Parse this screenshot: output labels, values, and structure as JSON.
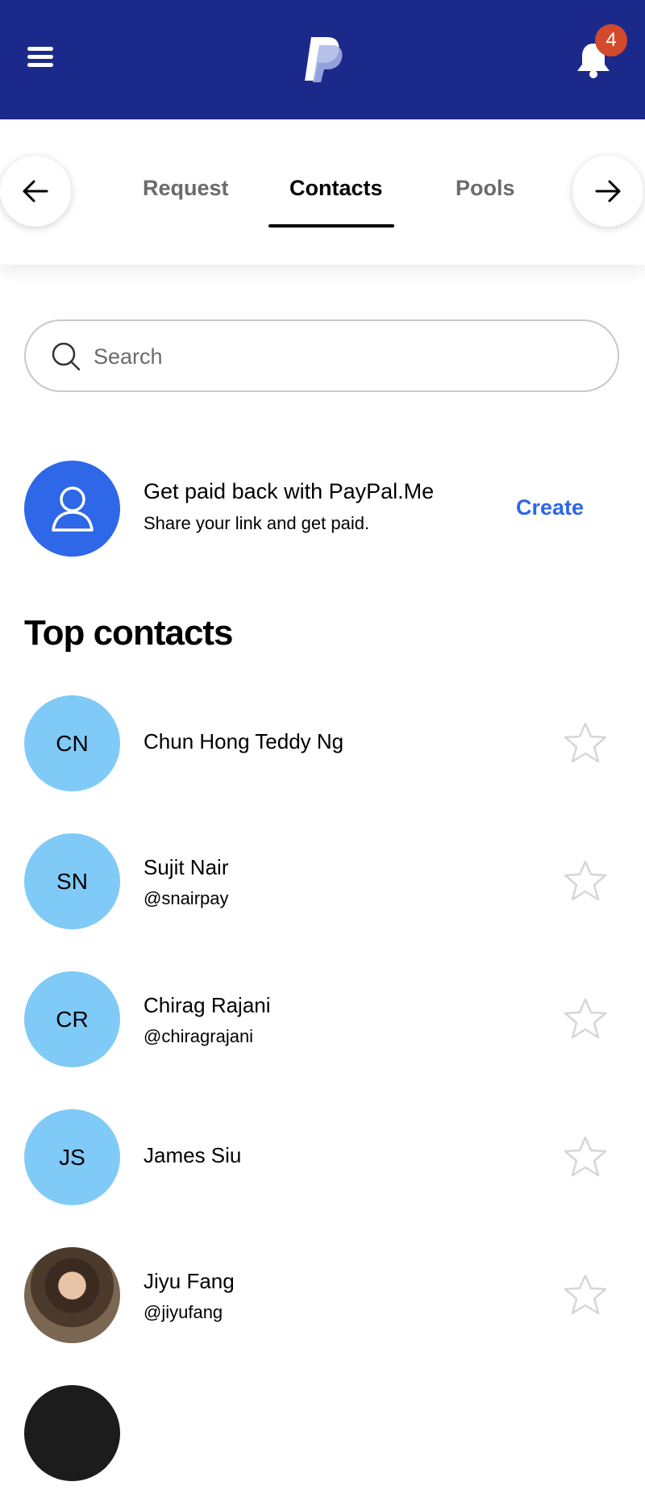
{
  "header": {
    "notification_count": "4",
    "colors": {
      "background": "#1b2a8a",
      "badge": "#d24a2b"
    }
  },
  "tabs": {
    "items": [
      {
        "label": "Request"
      },
      {
        "label": "Contacts",
        "active": true
      },
      {
        "label": "Pools"
      }
    ]
  },
  "search": {
    "placeholder": "Search",
    "value": ""
  },
  "promo": {
    "title": "Get paid back with PayPal.Me",
    "subtitle": "Share your link and get paid.",
    "action": "Create",
    "accent": "#2e67e8"
  },
  "top_contacts": {
    "heading": "Top contacts",
    "items": [
      {
        "initials": "CN",
        "name": "Chun Hong Teddy Ng",
        "handle": ""
      },
      {
        "initials": "SN",
        "name": "Sujit Nair",
        "handle": "@snairpay"
      },
      {
        "initials": "CR",
        "name": "Chirag Rajani",
        "handle": "@chiragrajani"
      },
      {
        "initials": "JS",
        "name": "James Siu",
        "handle": ""
      },
      {
        "initials": "",
        "name": "Jiyu Fang",
        "handle": "@jiyufang"
      }
    ]
  }
}
